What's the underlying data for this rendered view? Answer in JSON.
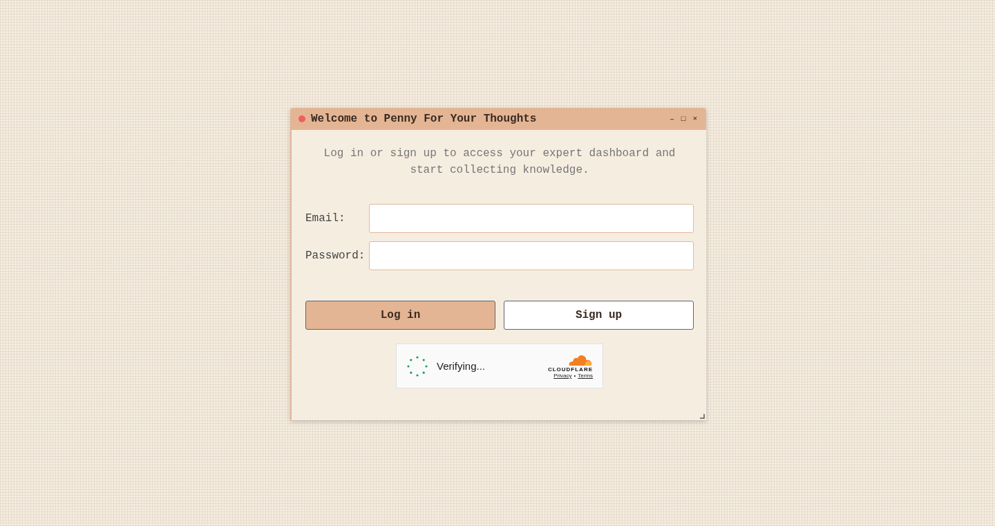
{
  "window": {
    "title": "Welcome to Penny For Your Thoughts",
    "controls": [
      "–",
      "□",
      "×"
    ]
  },
  "intro": "Log in or sign up to access your expert dashboard and start collecting knowledge.",
  "fields": [
    {
      "label": "Email:"
    },
    {
      "label": "Password:"
    }
  ],
  "buttons": [
    {
      "label": "Log in",
      "primary": true
    },
    {
      "label": "Sign up",
      "primary": false
    }
  ],
  "captcha": {
    "status": "Verifying...",
    "brand": "CLOUDFLARE",
    "links": [
      "Privacy",
      "Terms"
    ],
    "separator": "•"
  }
}
